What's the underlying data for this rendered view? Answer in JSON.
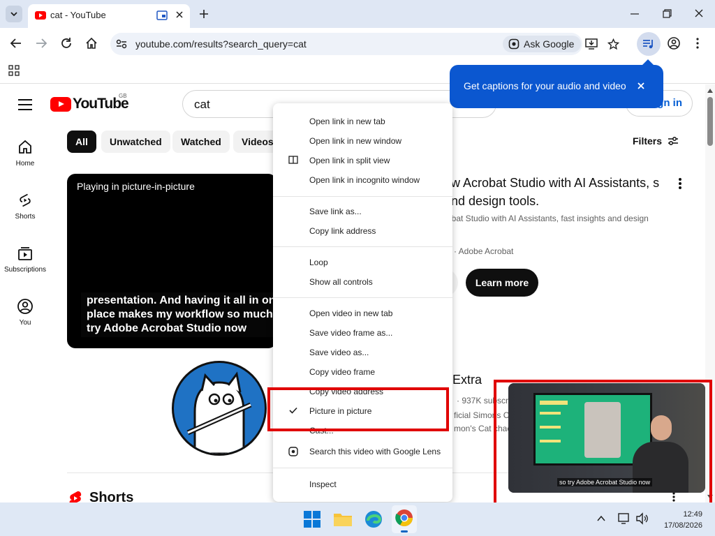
{
  "browser": {
    "tab_title": "cat - YouTube",
    "url": "youtube.com/results?search_query=cat",
    "ask_google": "Ask Google"
  },
  "captions_callout": {
    "text": "Get captions for your audio and video"
  },
  "youtube": {
    "logo_text": "YouTube",
    "country_code": "GB",
    "search_query": "cat",
    "sign_in": "Sign in",
    "sidebar": [
      {
        "label": "Home"
      },
      {
        "label": "Shorts"
      },
      {
        "label": "Subscriptions"
      },
      {
        "label": "You"
      }
    ],
    "chips": [
      "All",
      "Unwatched",
      "Watched",
      "Videos"
    ],
    "filters": "Filters",
    "player": {
      "pip_label": "Playing in picture-in-picture",
      "caption": "presentation. And having it all in one place makes my workflow so much So, try Adobe Acrobat Studio now"
    },
    "ad": {
      "title": "ew Acrobat Studio with AI Assistants, s and design tools.",
      "description": "robat Studio with AI Assistants, fast insights and design",
      "channel": "· Adobe Acrobat",
      "cta": "Learn more"
    },
    "channel_result": {
      "name": "Extra",
      "meta": "· 937K subscri",
      "desc1": "ficial Simons C",
      "desc2": "mon's Cat chac"
    },
    "shorts_heading": "Shorts"
  },
  "context_menu": {
    "groups": [
      [
        "Open link in new tab",
        "Open link in new window",
        "Open link in split view",
        "Open link in incognito window"
      ],
      [
        "Save link as...",
        "Copy link address"
      ],
      [
        "Loop",
        "Show all controls"
      ],
      [
        "Open video in new tab",
        "Save video frame as...",
        "Save video as...",
        "Copy video frame",
        "Copy video address",
        "Picture in picture",
        "Cast...",
        "Search this video with Google Lens"
      ],
      [
        "Inspect"
      ]
    ],
    "checked_item": "Picture in picture"
  },
  "pip_window": {
    "caption": "so try Adobe Acrobat Studio now"
  },
  "taskbar": {
    "time": "12:49",
    "date": "17/08/2026"
  },
  "colors": {
    "accent_blue": "#0b57d0",
    "youtube_red": "#ff0000",
    "highlight_red": "#e00000"
  }
}
